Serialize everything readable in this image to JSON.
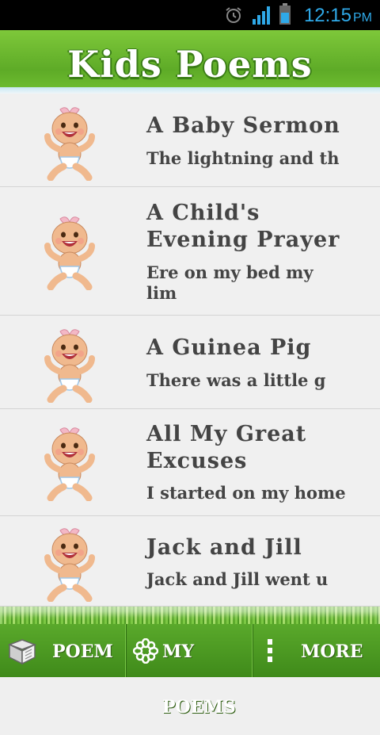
{
  "status_bar": {
    "time": "12:15",
    "ampm": "PM"
  },
  "header": {
    "title": "Kids Poems"
  },
  "poems": [
    {
      "title_lines": [
        "A Baby Sermon"
      ],
      "snippet_lines": [
        "The lightning and th"
      ]
    },
    {
      "title_lines": [
        "A Child's",
        "Evening Prayer"
      ],
      "snippet_lines": [
        "Ere on my bed my",
        "lim"
      ]
    },
    {
      "title_lines": [
        "A Guinea Pig"
      ],
      "snippet_lines": [
        "There was a little g"
      ]
    },
    {
      "title_lines": [
        "All My Great",
        "Excuses"
      ],
      "snippet_lines": [
        "I started on my home"
      ]
    },
    {
      "title_lines": [
        "Jack and Jill"
      ],
      "snippet_lines": [
        "Jack and Jill went u"
      ]
    }
  ],
  "bottom_nav": {
    "poem_label": "POEM",
    "my_poems_label": "MY POEMS",
    "more_label": "MORE"
  },
  "icons": {
    "row_icon": "baby-icon",
    "poem_tab": "book-icon",
    "my_poems_tab": "flower-icon",
    "more_tab": "more-dots-icon"
  },
  "colors": {
    "header_green": "#6cbb2f",
    "status_blue": "#2fa9e8",
    "text_dark": "#444444"
  }
}
